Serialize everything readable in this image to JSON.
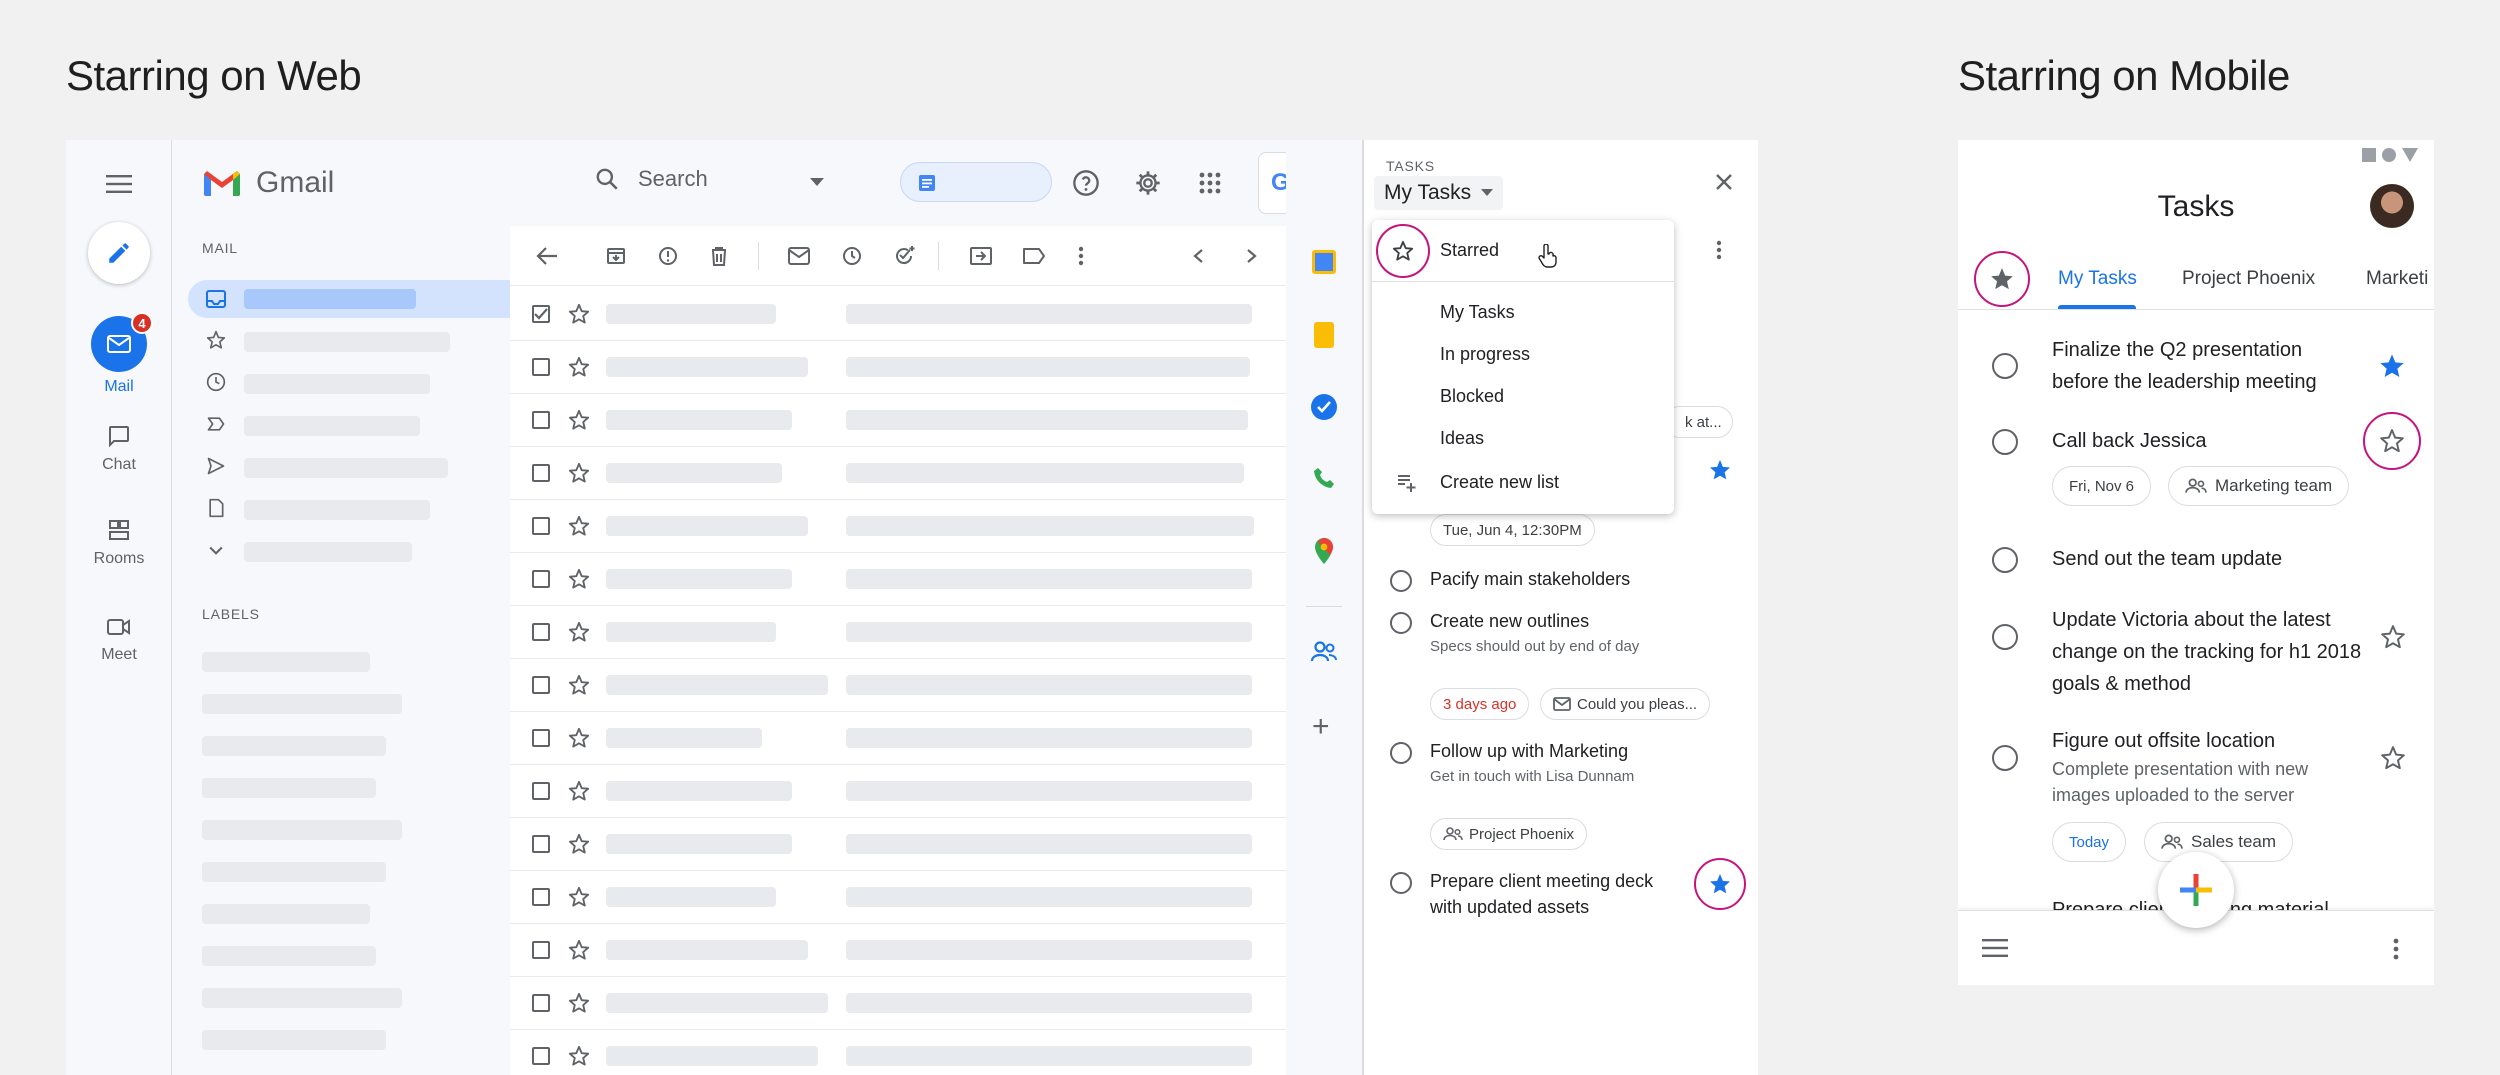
{
  "headings": {
    "web": "Starring on Web",
    "mobile": "Starring on Mobile"
  },
  "gmail": {
    "brand": "Gmail",
    "search_placeholder": "Search",
    "google_label": "Google",
    "compose_icon": "pencil-icon",
    "rail": {
      "mail": {
        "label": "Mail",
        "badge": "4"
      },
      "chat": {
        "label": "Chat"
      },
      "rooms": {
        "label": "Rooms"
      },
      "meet": {
        "label": "Meet"
      }
    },
    "sections": {
      "mail": "MAIL",
      "labels": "LABELS"
    },
    "inbox_count": "4",
    "nav_icons": [
      "inbox-icon",
      "star-icon",
      "clock-icon",
      "important-icon",
      "send-icon",
      "file-icon",
      "chevron-down-icon"
    ],
    "toolbar_icons": [
      "back-arrow-icon",
      "archive-icon",
      "report-icon",
      "delete-icon",
      "mail-icon",
      "snooze-icon",
      "add-task-icon",
      "move-icon",
      "label-icon",
      "more-icon",
      "prev-icon",
      "next-icon"
    ],
    "colors": {
      "accent": "#1a73e8",
      "badge": "#d93025",
      "highlight_ring": "#c5157a",
      "selected_bg": "#d3e3fd"
    }
  },
  "tasks_panel": {
    "header_label": "TASKS",
    "list_selector": "My Tasks",
    "menu": {
      "starred": "Starred",
      "items": [
        "My Tasks",
        "In progress",
        "Blocked",
        "Ideas"
      ],
      "create": "Create new list"
    },
    "partial_chip": "k at...",
    "date_chip": "Tue, Jun 4, 12:30PM",
    "items": [
      {
        "title": "Pacify main stakeholders"
      },
      {
        "title": "Create new outlines",
        "sub": "Specs should out by end of day",
        "chip_overdue": "3 days ago",
        "chip_mail": "Could you pleas..."
      },
      {
        "title": "Follow up with Marketing",
        "sub": "Get in touch with Lisa Dunnam",
        "chip_group": "Project Phoenix"
      },
      {
        "title": "Prepare client meeting deck with updated assets"
      }
    ]
  },
  "mobile": {
    "title": "Tasks",
    "tabs": [
      "My Tasks",
      "Project Phoenix",
      "Marketi"
    ],
    "items": [
      {
        "title": "Finalize the Q2 presentation before the leadership meeting",
        "starred": true
      },
      {
        "title": "Call back Jessica",
        "chip_date": "Fri, Nov 6",
        "chip_group": "Marketing team",
        "starred": false
      },
      {
        "title": "Send out the team update"
      },
      {
        "title": "Update Victoria about the latest change on the tracking for h1 2018 goals & method",
        "starred": false
      },
      {
        "title": "Figure out offsite location",
        "sub": "Complete presentation with new images uploaded to the server",
        "chip_date": "Today",
        "chip_group": "Sales team",
        "starred": false
      }
    ],
    "partial_item": "Prepare client meeting material"
  }
}
